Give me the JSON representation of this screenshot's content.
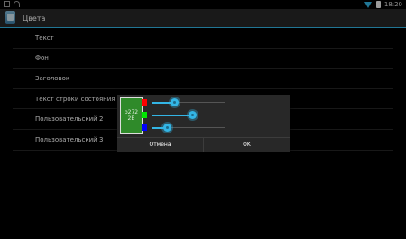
{
  "statusbar": {
    "time": "18:20"
  },
  "actionbar": {
    "title": "Цвета"
  },
  "list": {
    "items": [
      {
        "label": "Текст"
      },
      {
        "label": "Фон"
      },
      {
        "label": "Заголовок"
      },
      {
        "label": "Текст строки состояния"
      },
      {
        "label": "Пользовательский 2"
      },
      {
        "label": "Пользовательский 3"
      }
    ]
  },
  "dialog": {
    "preview_line1": "b272",
    "preview_line2": "2B",
    "preview_color": "#2f8a2a",
    "sliders": [
      {
        "name": "red",
        "color": "#ff0000",
        "value": 0.3
      },
      {
        "name": "green",
        "color": "#00e600",
        "value": 0.55
      },
      {
        "name": "blue",
        "color": "#0000ff",
        "value": 0.2
      }
    ],
    "cancel_label": "Отмена",
    "ok_label": "OK"
  },
  "colors": {
    "accent": "#33b5e5",
    "background": "#000000",
    "actionbar": "#272727"
  }
}
